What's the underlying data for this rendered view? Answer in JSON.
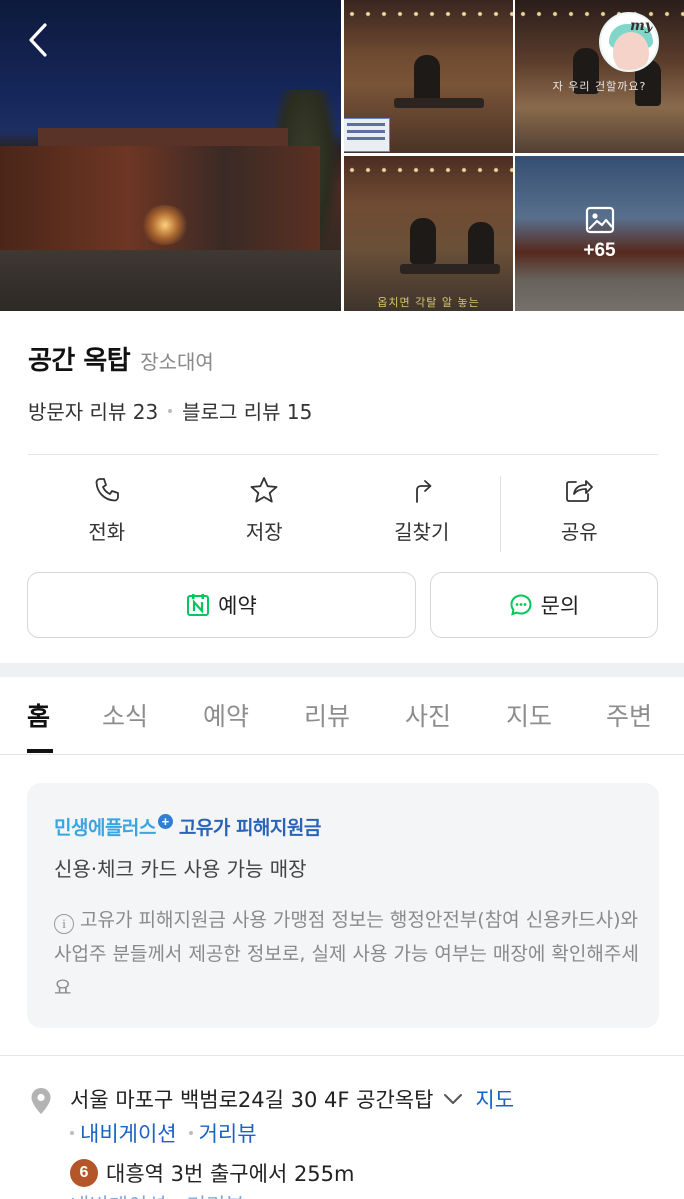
{
  "gallery": {
    "more_count": "+65",
    "subtitle_top_right": "자 우리 건할까요?",
    "subtitle_bottom_left": "옵치면 각탈 알 놓는"
  },
  "place": {
    "name": "공간 옥탑",
    "category": "장소대여",
    "visitor_reviews": "방문자 리뷰 23",
    "blog_reviews": "블로그 리뷰 15"
  },
  "actions": {
    "call": "전화",
    "save": "저장",
    "directions": "길찾기",
    "share": "공유"
  },
  "buttons": {
    "reserve": "예약",
    "inquiry": "문의"
  },
  "tabs": [
    "홈",
    "소식",
    "예약",
    "리뷰",
    "사진",
    "지도",
    "주변"
  ],
  "benefit": {
    "brand_a": "민생에플러스",
    "brand_b": "고유가 피해지원금",
    "subtitle": "신용·체크 카드 사용 가능 매장",
    "note": "고유가 피해지원금 사용 가맹점 정보는 행정안전부(참여 신용카드사)와 사업주 분들께서 제공한 정보로, 실제 사용 가능 여부는 매장에 확인해주세요"
  },
  "address": {
    "text": "서울 마포구 백범로24길 30 4F 공간옥탑",
    "map_link": "지도",
    "navigation": "내비게이션",
    "street_view": "거리뷰",
    "subway_line": "6",
    "subway_text": "대흥역 3번 출구에서 255m",
    "cutoff_text": "내비게이션 · 거리뷰"
  },
  "colors": {
    "accent_blue": "#1a62c6",
    "brand_light_blue": "#39a6e2",
    "naver_green": "#03c75a",
    "line6_brown": "#b5562a"
  }
}
